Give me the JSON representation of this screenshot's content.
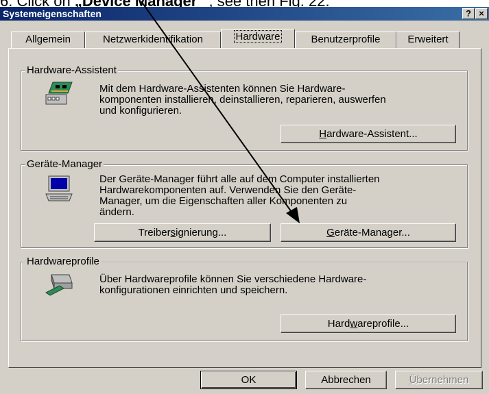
{
  "instruction": {
    "prefix": "6.  Click on ",
    "bold": "„Device Manager“",
    "suffix": " , see then Fig. 22."
  },
  "window": {
    "title": "Systemeigenschaften",
    "help_button": "?",
    "close_button": "×"
  },
  "tabs": [
    {
      "label": "Allgemein"
    },
    {
      "label": "Netzwerkidentifikation"
    },
    {
      "label": "Hardware"
    },
    {
      "label": "Benutzerprofile"
    },
    {
      "label": "Erweitert"
    }
  ],
  "active_tab": "Hardware",
  "groups": {
    "hardware_wizard": {
      "label": "Hardware-Assistent",
      "lines": [
        "Mit dem Hardware-Assistenten können Sie Hardware-",
        "komponenten installieren, deinstallieren, reparieren, auswerfen",
        "und konfigurieren."
      ],
      "button": {
        "before": "",
        "mnemonic": "H",
        "after": "ardware-Assistent..."
      }
    },
    "device_manager": {
      "label": "Geräte-Manager",
      "lines": [
        "Der Geräte-Manager führt alle auf dem Computer installierten",
        "Hardwarekomponenten auf. Verwenden Sie den Geräte-",
        "Manager, um die Eigenschaften aller Komponenten zu",
        "ändern."
      ],
      "driver_button": {
        "before": "Treiber",
        "mnemonic": "s",
        "after": "ignierung..."
      },
      "manager_button": {
        "before": "",
        "mnemonic": "G",
        "after": "eräte-Manager..."
      }
    },
    "hardware_profiles": {
      "label": "Hardwareprofile",
      "lines": [
        "Über Hardwareprofile können Sie verschiedene Hardware-",
        "konfigurationen einrichten und speichern."
      ],
      "button": {
        "before": "Hard",
        "mnemonic": "w",
        "after": "areprofile..."
      }
    }
  },
  "footer": {
    "ok": "OK",
    "cancel": "Abbrechen",
    "apply": {
      "before": "",
      "mnemonic": "Ü",
      "after": "bernehmen"
    }
  },
  "colors": {
    "titlebar_start": "#0a246a",
    "titlebar_end": "#3a6ea5",
    "face": "#d4d0c8"
  }
}
